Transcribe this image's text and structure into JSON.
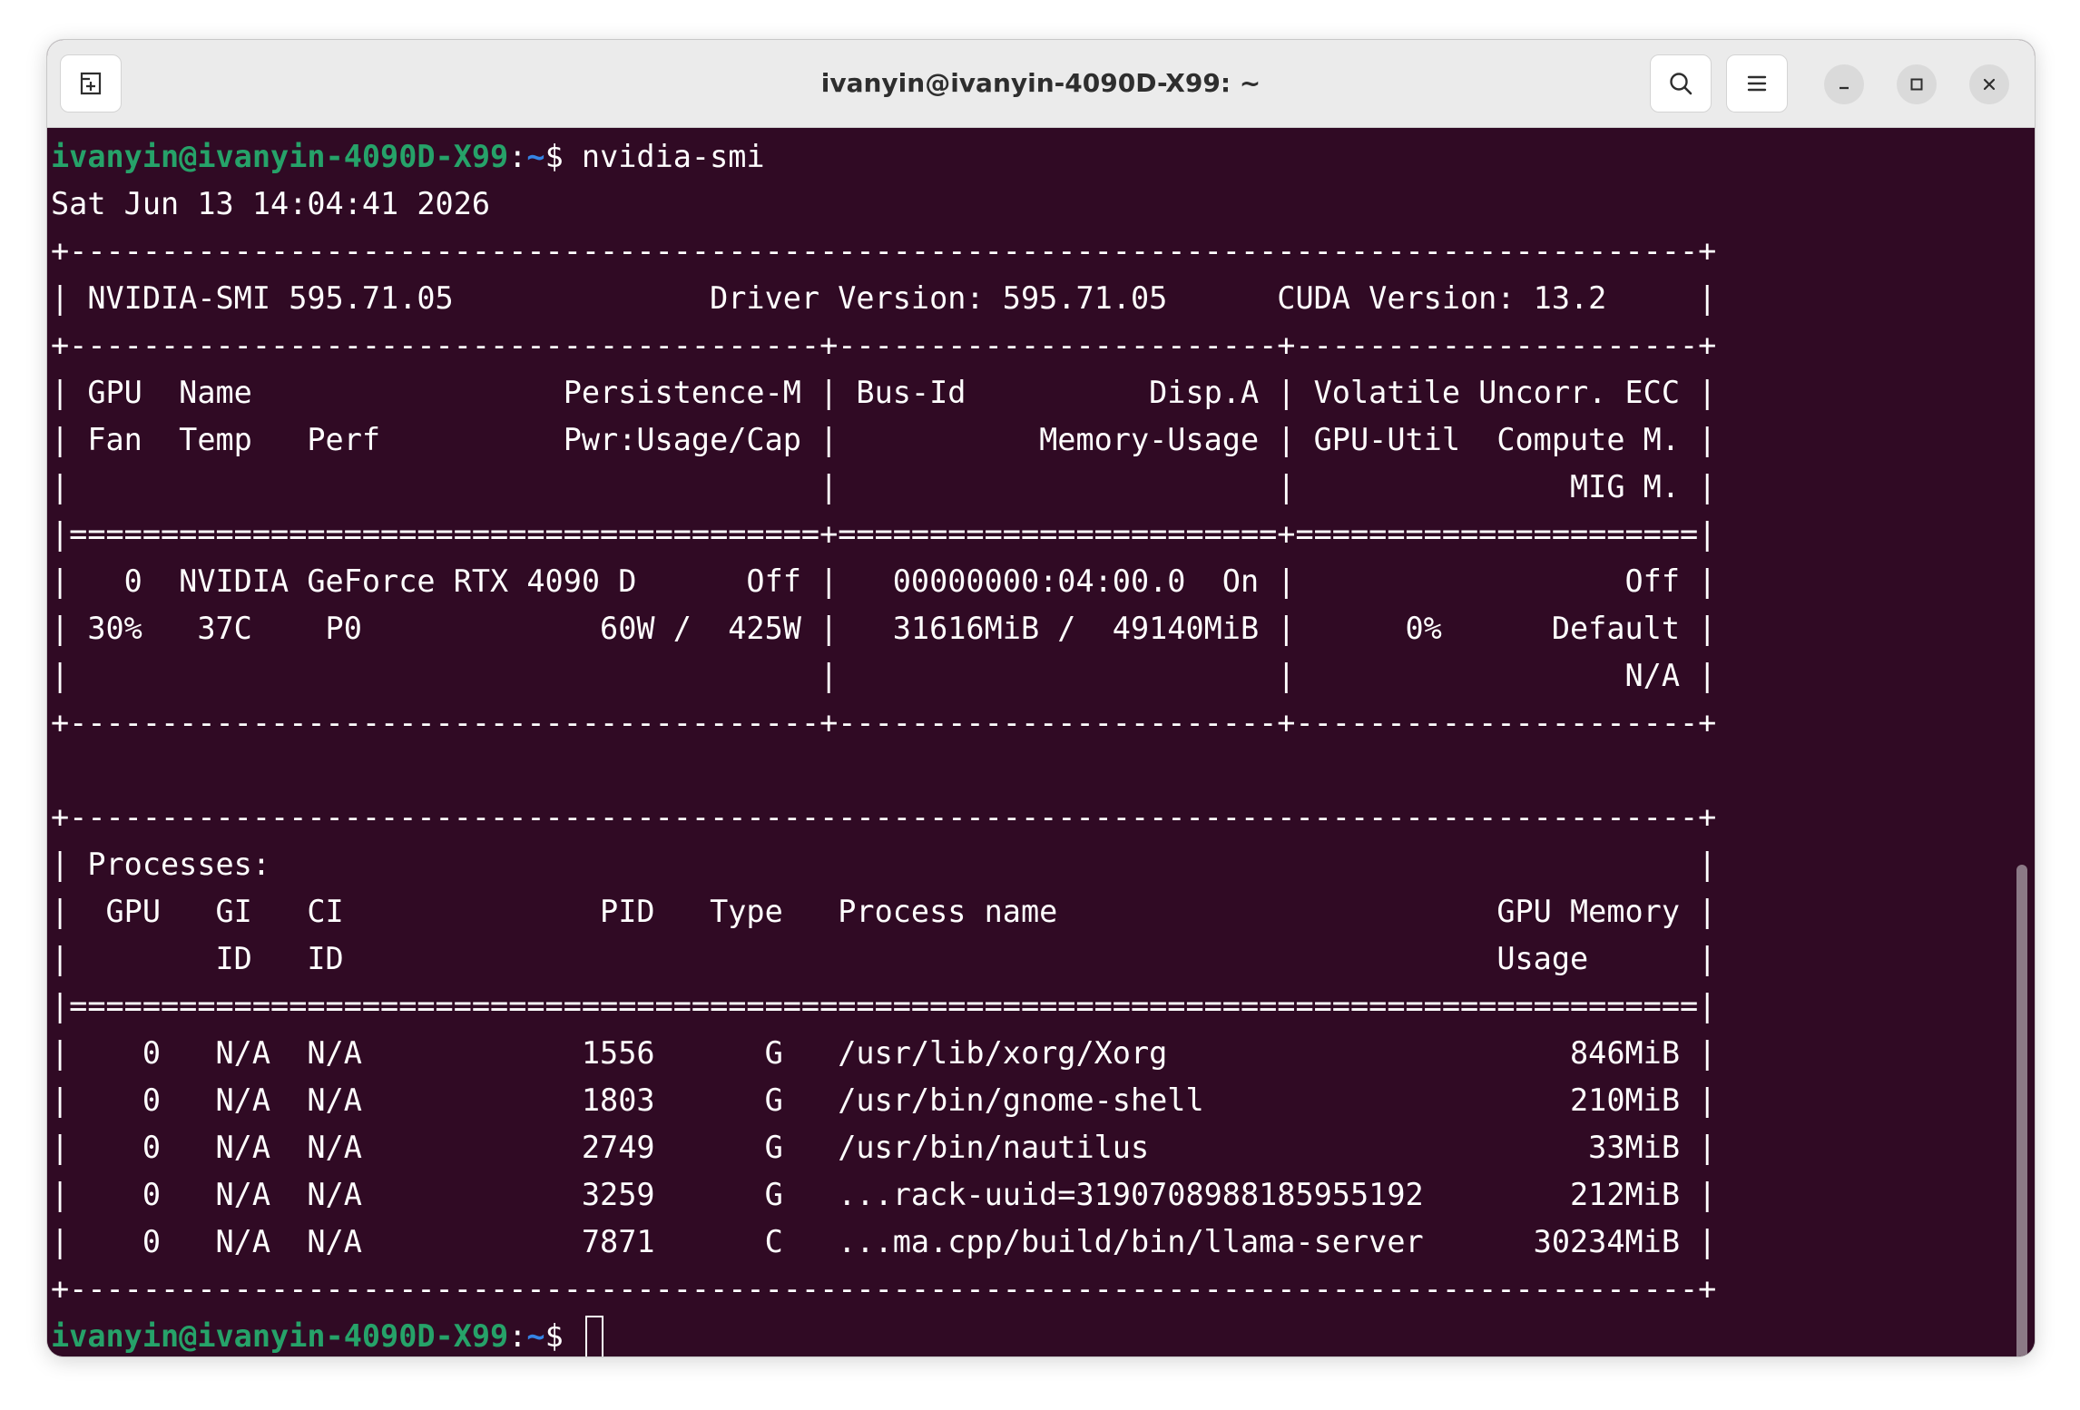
{
  "window": {
    "title": "ivanyin@ivanyin-4090D-X99: ~"
  },
  "icons": {
    "new_tab": "new-tab-icon",
    "search": "search-icon",
    "menu": "hamburger-menu-icon",
    "minimize": "minimize-icon",
    "maximize": "maximize-icon",
    "close": "close-icon"
  },
  "colors": {
    "terminal_bg": "#300a24",
    "prompt_user": "#26a269",
    "prompt_path": "#3584e4",
    "text": "#ffffff"
  },
  "prompt": {
    "user_host": "ivanyin@ivanyin-4090D-X99",
    "colon": ":",
    "path": "~",
    "dollar": "$ "
  },
  "command": "nvidia-smi",
  "output_lines": [
    "Sat Jun 13 14:04:41 2026",
    "+-----------------------------------------------------------------------------------------+",
    "| NVIDIA-SMI 595.71.05              Driver Version: 595.71.05      CUDA Version: 13.2     |",
    "+-----------------------------------------+------------------------+----------------------+",
    "| GPU  Name                 Persistence-M | Bus-Id          Disp.A | Volatile Uncorr. ECC |",
    "| Fan  Temp   Perf          Pwr:Usage/Cap |           Memory-Usage | GPU-Util  Compute M. |",
    "|                                         |                        |               MIG M. |",
    "|=========================================+========================+======================|",
    "|   0  NVIDIA GeForce RTX 4090 D      Off |   00000000:04:00.0  On |                  Off |",
    "| 30%   37C    P0             60W /  425W |   31616MiB /  49140MiB |      0%      Default |",
    "|                                         |                        |                  N/A |",
    "+-----------------------------------------+------------------------+----------------------+",
    "",
    "+-----------------------------------------------------------------------------------------+",
    "| Processes:                                                                              |",
    "|  GPU   GI   CI              PID   Type   Process name                        GPU Memory |",
    "|        ID   ID                                                               Usage      |",
    "|=========================================================================================|",
    "|    0   N/A  N/A            1556      G   /usr/lib/xorg/Xorg                      846MiB |",
    "|    0   N/A  N/A            1803      G   /usr/bin/gnome-shell                    210MiB |",
    "|    0   N/A  N/A            2749      G   /usr/bin/nautilus                        33MiB |",
    "|    0   N/A  N/A            3259      G   ...rack-uuid=3190708988185955192        212MiB |",
    "|    0   N/A  N/A            7871      C   ...ma.cpp/build/bin/llama-server      30234MiB |",
    "+-----------------------------------------------------------------------------------------+"
  ]
}
